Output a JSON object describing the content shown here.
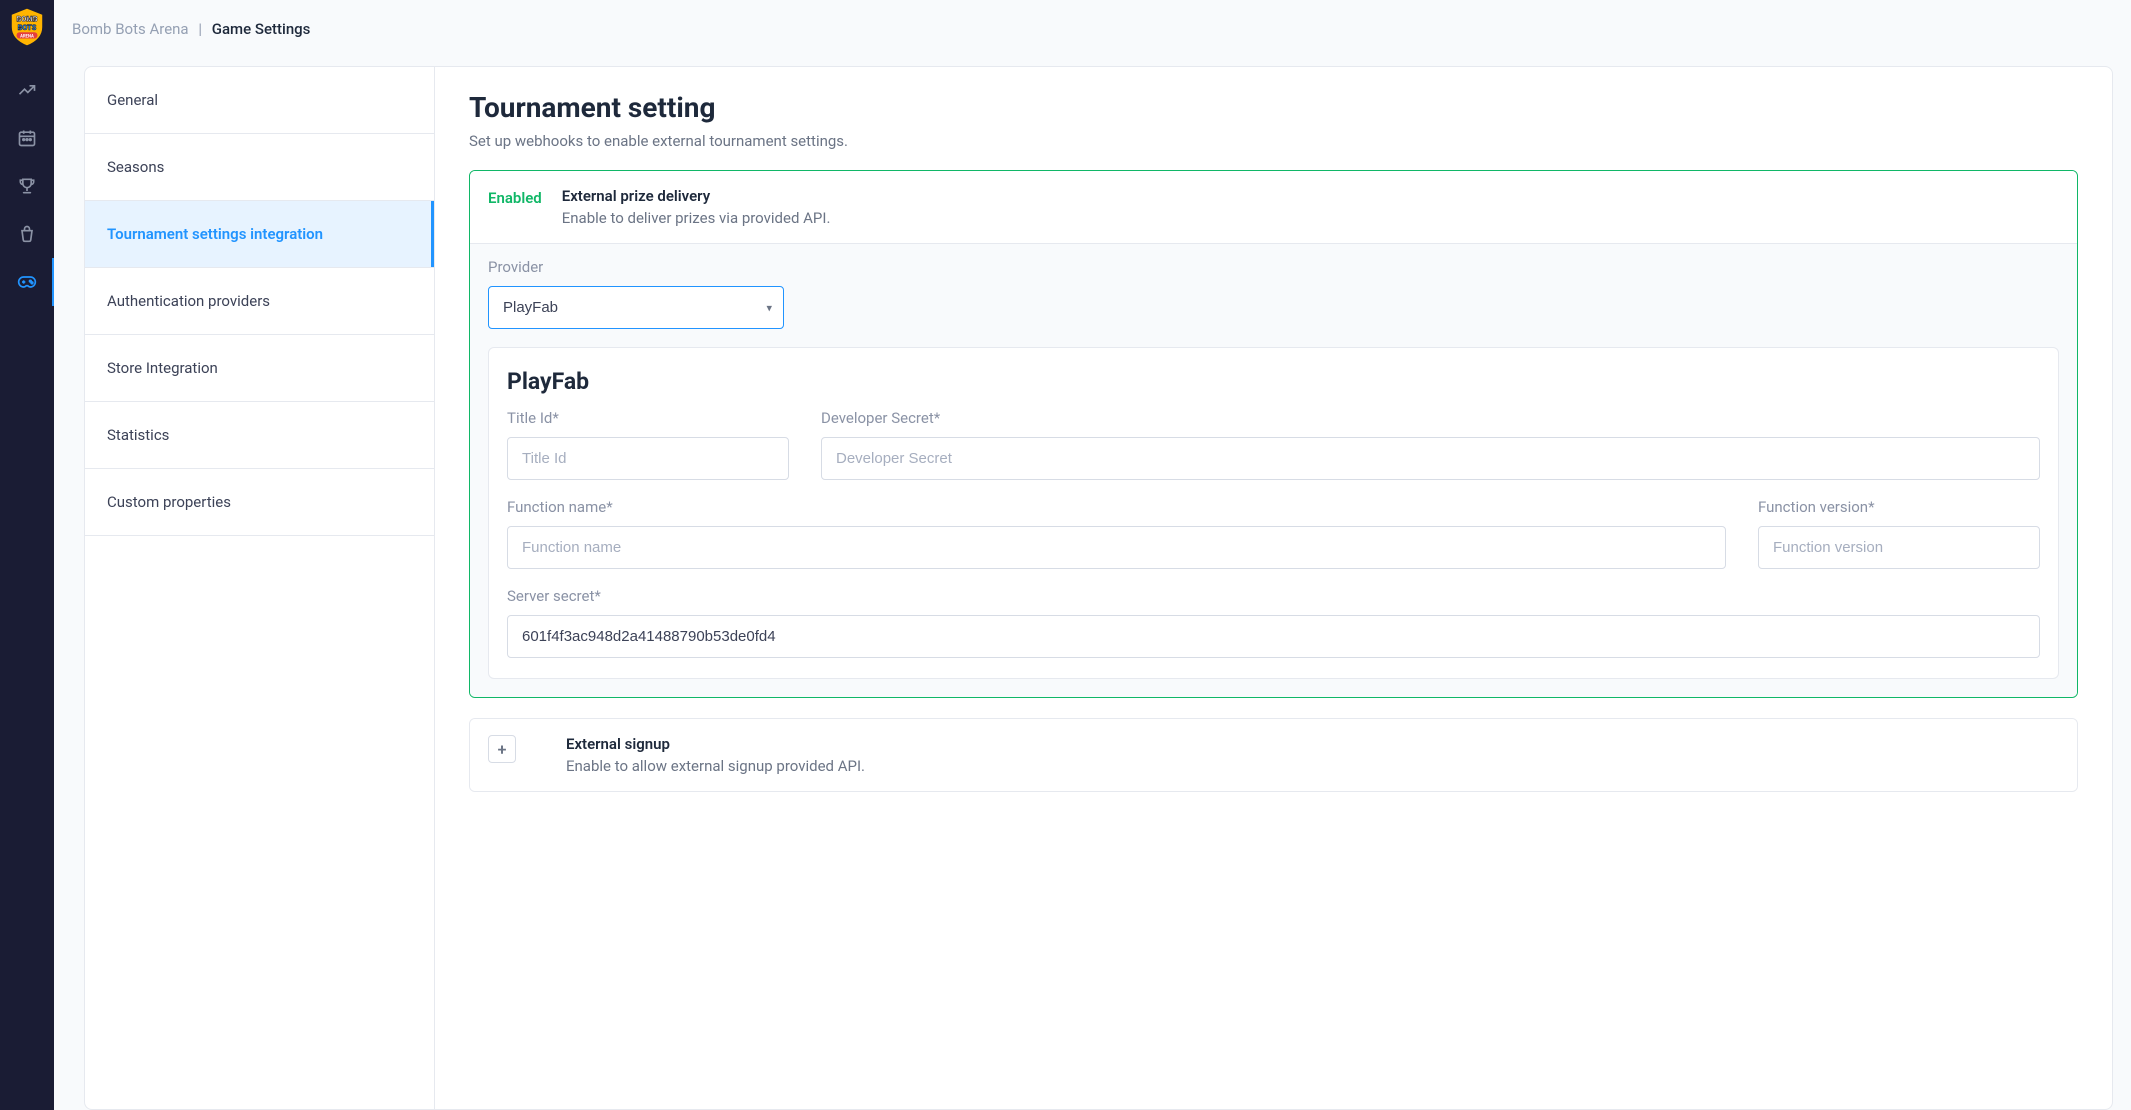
{
  "breadcrumb": {
    "app": "Bomb Bots Arena",
    "page": "Game Settings"
  },
  "settingsNav": {
    "general": "General",
    "seasons": "Seasons",
    "tournament": "Tournament settings integration",
    "auth": "Authentication providers",
    "store": "Store Integration",
    "statistics": "Statistics",
    "custom": "Custom properties"
  },
  "page": {
    "title": "Tournament setting",
    "subtitle": "Set up webhooks to enable external tournament settings."
  },
  "prizeCard": {
    "status": "Enabled",
    "title": "External prize delivery",
    "desc": "Enable to deliver prizes via provided API.",
    "providerLabel": "Provider",
    "providerValue": "PlayFab",
    "playfab": {
      "title": "PlayFab",
      "titleIdLabel": "Title Id*",
      "titleIdPlaceholder": "Title Id",
      "devSecretLabel": "Developer Secret*",
      "devSecretPlaceholder": "Developer Secret",
      "funcNameLabel": "Function name*",
      "funcNamePlaceholder": "Function name",
      "funcVersionLabel": "Function version*",
      "funcVersionPlaceholder": "Function version",
      "serverSecretLabel": "Server secret*",
      "serverSecretValue": "601f4f3ac948d2a41488790b53de0fd4"
    }
  },
  "signupCard": {
    "title": "External signup",
    "desc": "Enable to allow external signup provided API.",
    "toggle": "+"
  }
}
